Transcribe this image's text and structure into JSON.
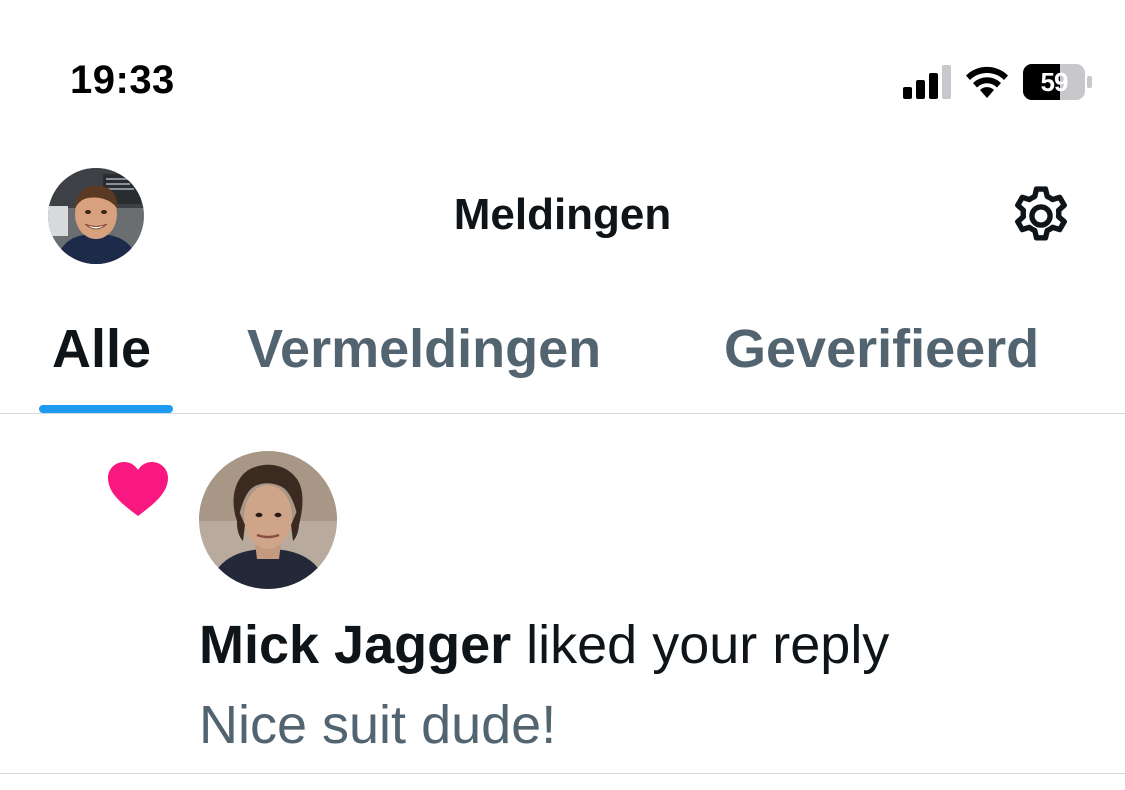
{
  "status_bar": {
    "time": "19:33",
    "battery_level": "59",
    "icons": [
      "signal-icon",
      "wifi-icon",
      "battery-icon"
    ]
  },
  "header": {
    "title": "Meldingen",
    "avatar_icon": "profile-avatar",
    "settings_icon": "gear-icon"
  },
  "tabs": [
    {
      "label": "Alle",
      "active": true
    },
    {
      "label": "Vermeldingen",
      "active": false
    },
    {
      "label": "Geverifieerd",
      "active": false
    }
  ],
  "notifications": [
    {
      "type_icon": "heart-icon",
      "user": "Mick Jagger",
      "action": "liked your reply",
      "preview": "Nice suit dude!"
    }
  ],
  "colors": {
    "accent": "#1d9bf0",
    "like": "#f91880",
    "text_primary": "#0f1419",
    "text_secondary": "#536471",
    "divider": "#cfd9de"
  }
}
